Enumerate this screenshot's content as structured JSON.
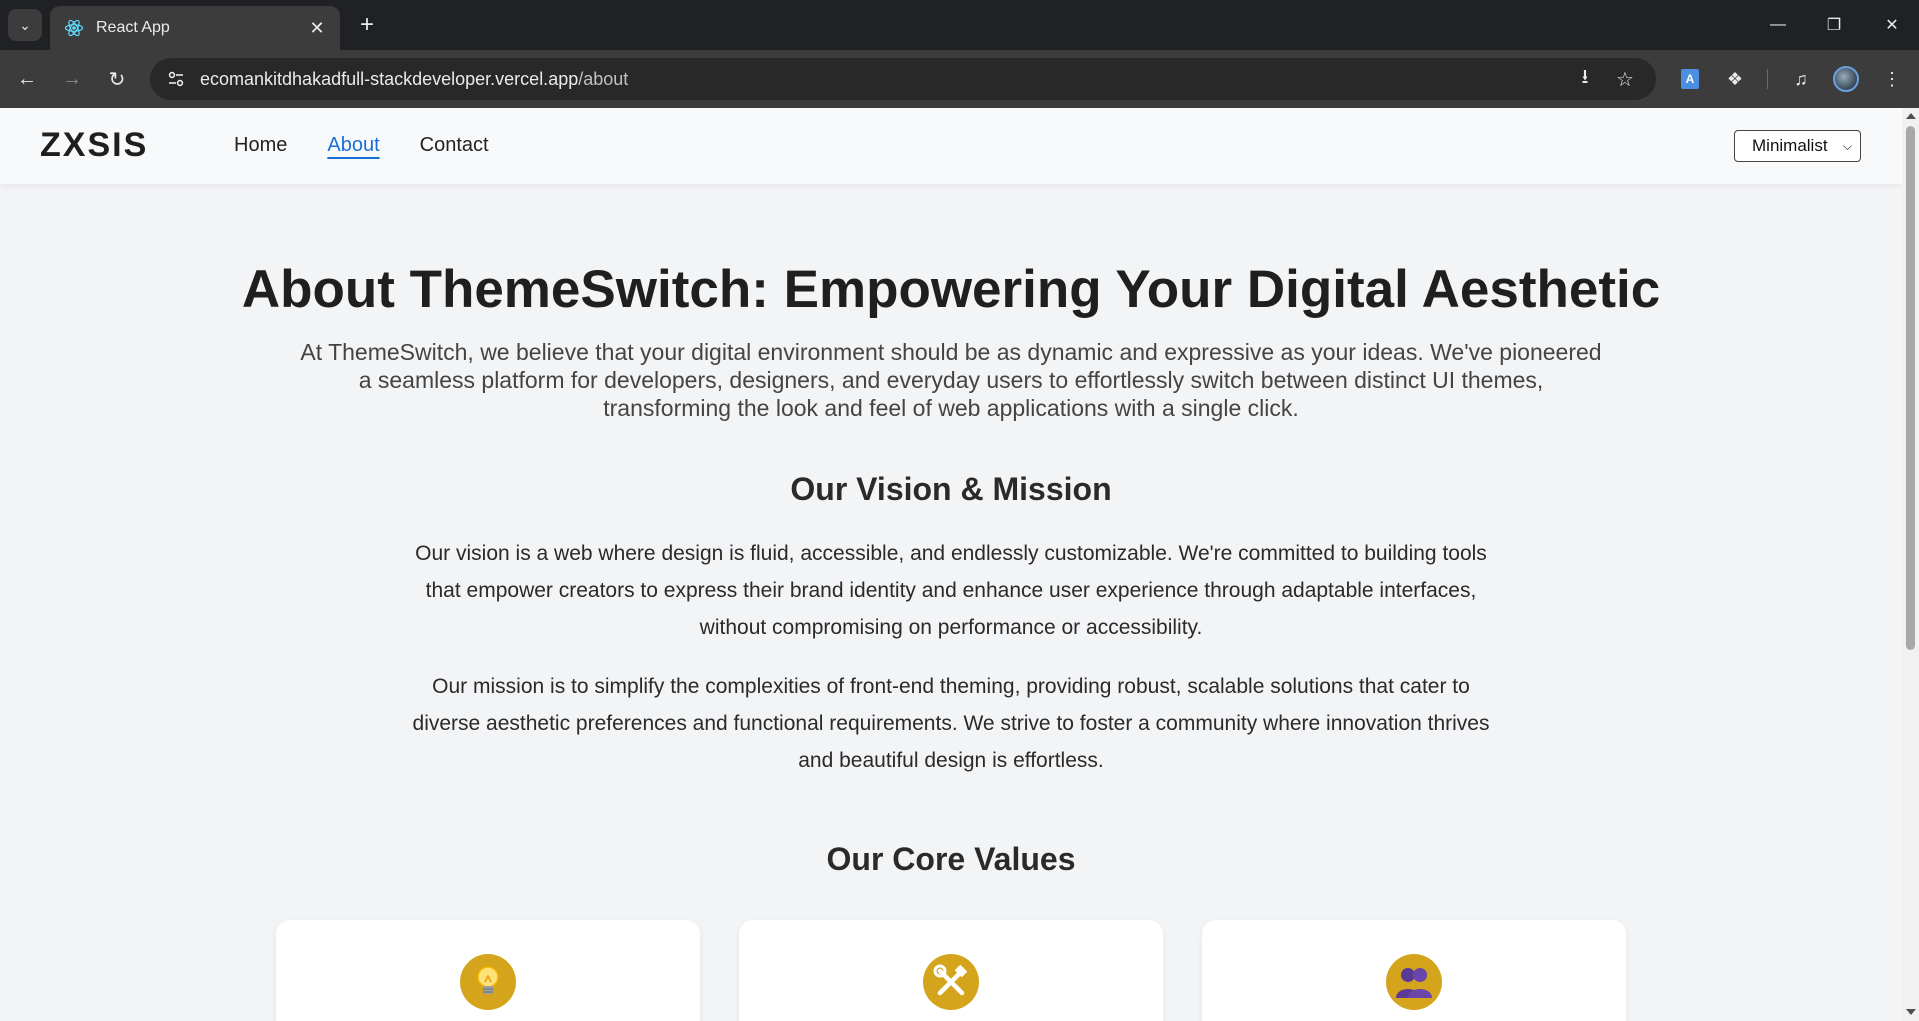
{
  "browser": {
    "tab_title": "React App",
    "url_host": "ecomankitdhakadfull-stackdeveloper.vercel.app",
    "url_path": "/about"
  },
  "site": {
    "logo": "ZXSIS",
    "nav": [
      {
        "label": "Home",
        "active": false
      },
      {
        "label": "About",
        "active": true
      },
      {
        "label": "Contact",
        "active": false
      }
    ],
    "theme_select": "Minimalist"
  },
  "hero": {
    "title": "About ThemeSwitch: Empowering Your Digital Aesthetic",
    "text": "At ThemeSwitch, we believe that your digital environment should be as dynamic and expressive as your ideas. We've pioneered a seamless platform for developers, designers, and everyday users to effortlessly switch between distinct UI themes, transforming the look and feel of web applications with a single click."
  },
  "vision": {
    "title": "Our Vision & Mission",
    "vision_text": "Our vision is a web where design is fluid, accessible, and endlessly customizable. We're committed to building tools that empower creators to express their brand identity and enhance user experience through adaptable interfaces, without compromising on performance or accessibility.",
    "mission_text": "Our mission is to simplify the complexities of front-end theming, providing robust, scalable solutions that cater to diverse aesthetic preferences and functional requirements. We strive to foster a community where innovation thrives and beautiful design is effortless."
  },
  "values": {
    "title": "Our Core Values",
    "cards": [
      {
        "icon": "lightbulb-icon"
      },
      {
        "icon": "tools-icon"
      },
      {
        "icon": "community-icon"
      }
    ]
  },
  "colors": {
    "accent": "#1a6fd6",
    "icon_bg": "#d4a51c",
    "page_bg": "#f3f4f6"
  }
}
